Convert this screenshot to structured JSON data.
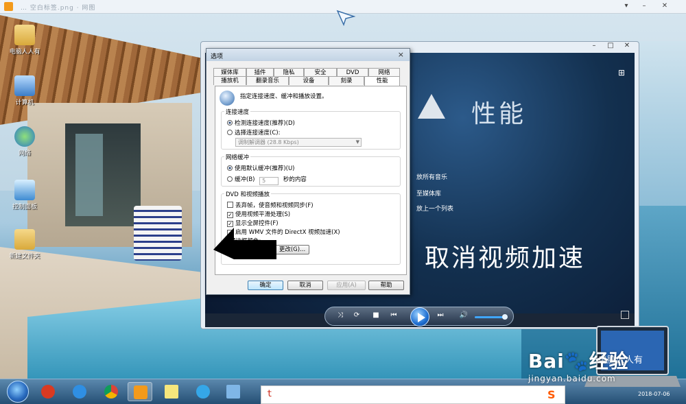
{
  "browser": {
    "faded_tab_text": "… 空白标签.png · 网图"
  },
  "desktop_icons": [
    {
      "label": "电脑人人有",
      "icon": "folder-user-icon"
    },
    {
      "label": "计算机",
      "icon": "computer-icon"
    },
    {
      "label": "网络",
      "icon": "network-globe-icon"
    },
    {
      "label": "控制面板",
      "icon": "control-panel-icon"
    },
    {
      "label": "新建文件夹",
      "icon": "folder-icon"
    }
  ],
  "player": {
    "section_title": "性能",
    "side_links": [
      "放所有音乐",
      "至媒体库",
      "放上一个列表"
    ],
    "caption": "取消视频加速"
  },
  "dialog": {
    "title": "选项",
    "close": "×",
    "tabs_row1": [
      "媒体库",
      "插件",
      "隐私",
      "安全",
      "DVD",
      "网络"
    ],
    "tabs_row2": [
      "播放机",
      "翻录音乐",
      "设备",
      "刻录",
      "性能"
    ],
    "active_tab": "性能",
    "info": "指定连接速度、缓冲和播放设置。",
    "connection": {
      "title": "连接速度",
      "opt_detect": "检测连接速度(推荐)(D)",
      "opt_select": "选择连接速度(C):",
      "select_value": "调制解调器 (28.8 Kbps)"
    },
    "buffer": {
      "title": "网络缓冲",
      "opt_default": "使用默认缓冲(推荐)(U)",
      "opt_buffer": "缓冲(B)",
      "buffer_value": "5",
      "buffer_suffix": "秒的内容"
    },
    "dvd": {
      "title": "DVD 和视频播放",
      "opt_drop": "丢弃帧，使音频和视频同步(F)",
      "opt_smooth": "使用视频平滑处理(S)",
      "opt_fullscreen": "显示全屏控件(F)",
      "opt_directx": "启用 WMV 文件的 DirectX 视频加速(X)",
      "border_label": "频边框颜色:",
      "change_button": "更改(G)..."
    },
    "buttons": {
      "ok": "确定",
      "cancel": "取消",
      "apply": "应用(A)",
      "help": "帮助"
    }
  },
  "input_bar": {
    "value": "t"
  },
  "taskbar": {
    "items": [
      "360-browser-icon",
      "ie-icon",
      "chrome-icon",
      "media-player-icon",
      "sticky-notes-icon",
      "qq-browser-icon",
      "monitor-icon"
    ],
    "date": "2018-07-06"
  },
  "watermark": {
    "brand_left": "Bai",
    "brand_right": "经验",
    "url": "jingyan.baidu.com",
    "laptop_text": "电脑人人有"
  }
}
